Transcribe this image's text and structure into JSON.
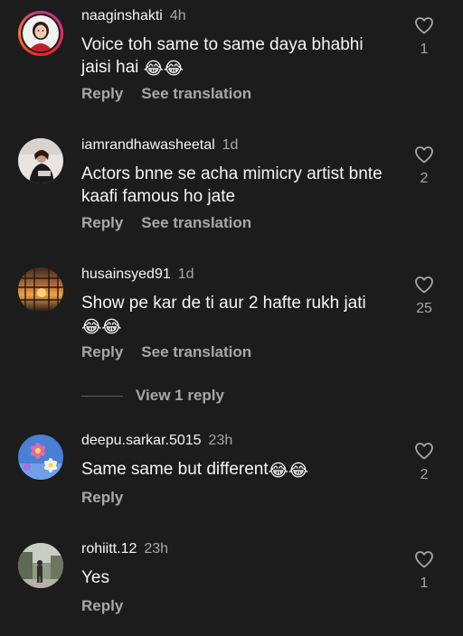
{
  "comments": [
    {
      "username": "naaginshakti",
      "time": "4h",
      "text": "Voice toh same to same daya bhabhi jaisi hai",
      "emojis": "😂😂",
      "reply_label": "Reply",
      "translate_label": "See translation",
      "likes": "1"
    },
    {
      "username": "iamrandhawasheetal",
      "time": "1d",
      "text": "Actors bnne se acha mimicry artist bnte kaafi famous ho jate",
      "emojis": "",
      "reply_label": "Reply",
      "translate_label": "See translation",
      "likes": "2"
    },
    {
      "username": "husainsyed91",
      "time": "1d",
      "text": "Show pe kar de ti aur 2 hafte rukh jati",
      "emojis": "😂😂",
      "reply_label": "Reply",
      "translate_label": "See translation",
      "likes": "25",
      "view_replies_label": "View 1 reply"
    },
    {
      "username": "deepu.sarkar.5015",
      "time": "23h",
      "text": "Same same but different",
      "emojis": "😂😂",
      "reply_label": "Reply",
      "likes": "2"
    },
    {
      "username": "rohiitt.12",
      "time": "23h",
      "text": "Yes",
      "emojis": "",
      "reply_label": "Reply",
      "likes": "1"
    }
  ],
  "colors": {
    "background": "#1c1c1c",
    "primary_text": "#f5f5f5",
    "secondary_text": "#a8a8a8",
    "story_ring": "#e1306c"
  },
  "icons": {
    "like": "heart-outline-icon"
  }
}
